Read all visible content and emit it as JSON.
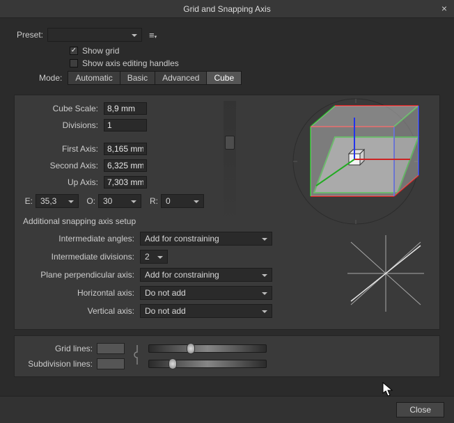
{
  "window": {
    "title": "Grid and Snapping Axis",
    "close_btn": "×"
  },
  "preset": {
    "label": "Preset:",
    "value": ""
  },
  "checks": {
    "show_grid": "Show grid",
    "show_axis_handles": "Show axis editing handles"
  },
  "mode": {
    "label": "Mode:",
    "options": [
      "Automatic",
      "Basic",
      "Advanced",
      "Cube"
    ],
    "active": "Cube"
  },
  "cube_fields": {
    "cube_scale_label": "Cube Scale:",
    "cube_scale_value": "8,9 mm",
    "divisions_label": "Divisions:",
    "divisions_value": "1",
    "first_axis_label": "First Axis:",
    "first_axis_value": "8,165 mm",
    "second_axis_label": "Second Axis:",
    "second_axis_value": "6,325 mm",
    "up_axis_label": "Up Axis:",
    "up_axis_value": "7,303 mm"
  },
  "eor": {
    "e_label": "E:",
    "e_value": "35,3",
    "o_label": "O:",
    "o_value": "30",
    "r_label": "R:",
    "r_value": "0"
  },
  "snap": {
    "title": "Additional snapping axis setup",
    "intermediate_angles_label": "Intermediate angles:",
    "intermediate_angles_value": "Add for constraining",
    "intermediate_divisions_label": "Intermediate divisions:",
    "intermediate_divisions_value": "2",
    "plane_perp_label": "Plane perpendicular axis:",
    "plane_perp_value": "Add for constraining",
    "horizontal_label": "Horizontal axis:",
    "horizontal_value": "Do not add",
    "vertical_label": "Vertical axis:",
    "vertical_value": "Do not add"
  },
  "sliders": {
    "grid_lines_label": "Grid lines:",
    "subdivision_lines_label": "Subdivision lines:"
  },
  "footer": {
    "close": "Close"
  }
}
